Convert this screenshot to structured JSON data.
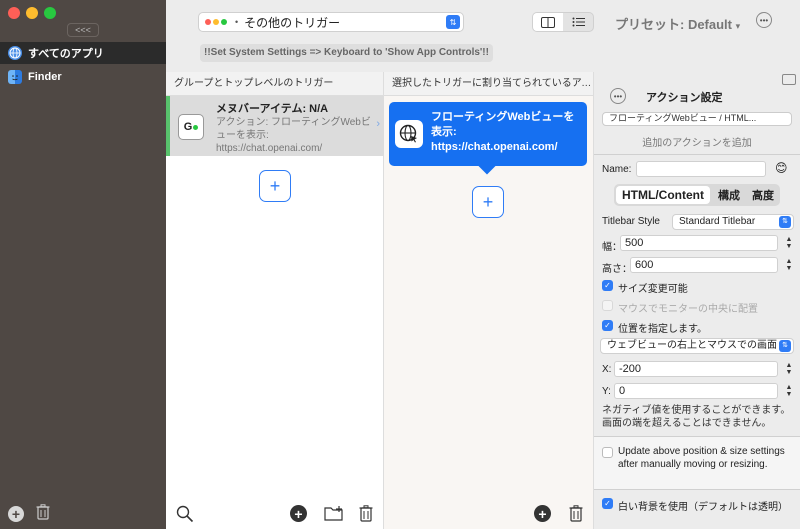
{
  "sidebar": {
    "collapse_label": "<<<",
    "items": [
      {
        "label": "すべてのアプリ",
        "icon": "globe-icon"
      },
      {
        "label": "Finder",
        "icon": "finder-icon"
      }
    ],
    "add_label": "+",
    "delete_label": "🗑"
  },
  "toolbar": {
    "trigger_select": "その他のトリガー",
    "preset_label": "プリセット: Default",
    "preset_arrow": "▾",
    "notice": "!!Set System Settings => Keyboard to 'Show App Controls'!!"
  },
  "triggers_column": {
    "header": "グループとトップレベルのトリガー",
    "item": {
      "icon_label": "G",
      "title": "メヌバーアイテム: N/A",
      "description": "アクション: フローティングWebビューを表示: https://chat.openai.com/"
    },
    "add_label": "+"
  },
  "actions_column": {
    "header": "選択したトリガーに割り当てられているアク…",
    "card_text": "フローティングWebビューを表示: https://chat.openai.com/",
    "add_label": "+"
  },
  "panel": {
    "title": "アクション設定",
    "cut_select": "フローティングWebビュー / HTML...",
    "add_action": "追加のアクションを追加",
    "name_label": "Name:",
    "name_value": "",
    "name_emoji": "😊",
    "tabs": [
      "HTML/Content",
      "構成",
      "高度"
    ],
    "titlebar_label": "Titlebar Style",
    "titlebar_value": "Standard Titlebar",
    "width_label": "幅：",
    "width_value": "500",
    "height_label": "高さ：",
    "height_value": "600",
    "resizable_label": "サイズ変更可能",
    "center_label": "マウスでモニターの中央に配置",
    "position_label": "位置を指定します。",
    "anchor_value": "ウェブビューの右上とマウスでの画面",
    "x_label": "X:",
    "x_value": "-200",
    "y_label": "Y:",
    "y_value": "0",
    "note": "ネガティブ値を使用することができます。画面の端を超えることはできません。",
    "update_label": "Update above position & size settings after manually moving or resizing.",
    "white_bg_label": "白い背景を使用（デフォルトは透明）"
  },
  "colors": {
    "accent": "#2f7cf6",
    "sidebar_bg": "#4f4844",
    "selected_green": "#58c26c",
    "traffic_red": "#fe5f57",
    "traffic_yellow": "#febc2e",
    "traffic_green": "#28c840"
  }
}
